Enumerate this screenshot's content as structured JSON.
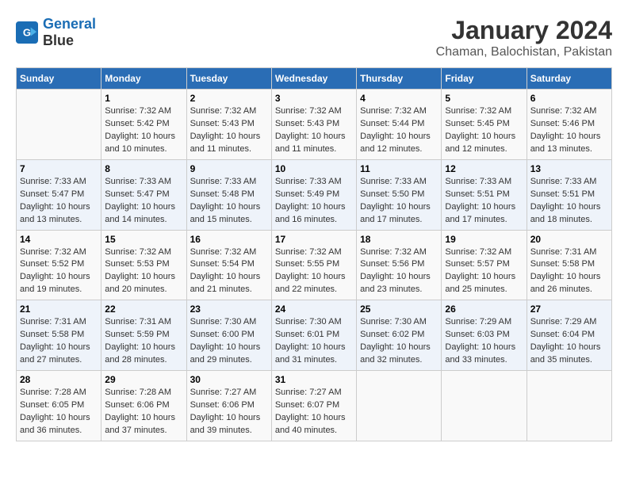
{
  "header": {
    "logo_line1": "General",
    "logo_line2": "Blue",
    "title": "January 2024",
    "subtitle": "Chaman, Balochistan, Pakistan"
  },
  "columns": [
    "Sunday",
    "Monday",
    "Tuesday",
    "Wednesday",
    "Thursday",
    "Friday",
    "Saturday"
  ],
  "weeks": [
    [
      {
        "day": "",
        "info": ""
      },
      {
        "day": "1",
        "info": "Sunrise: 7:32 AM\nSunset: 5:42 PM\nDaylight: 10 hours\nand 10 minutes."
      },
      {
        "day": "2",
        "info": "Sunrise: 7:32 AM\nSunset: 5:43 PM\nDaylight: 10 hours\nand 11 minutes."
      },
      {
        "day": "3",
        "info": "Sunrise: 7:32 AM\nSunset: 5:43 PM\nDaylight: 10 hours\nand 11 minutes."
      },
      {
        "day": "4",
        "info": "Sunrise: 7:32 AM\nSunset: 5:44 PM\nDaylight: 10 hours\nand 12 minutes."
      },
      {
        "day": "5",
        "info": "Sunrise: 7:32 AM\nSunset: 5:45 PM\nDaylight: 10 hours\nand 12 minutes."
      },
      {
        "day": "6",
        "info": "Sunrise: 7:32 AM\nSunset: 5:46 PM\nDaylight: 10 hours\nand 13 minutes."
      }
    ],
    [
      {
        "day": "7",
        "info": "Sunrise: 7:33 AM\nSunset: 5:47 PM\nDaylight: 10 hours\nand 13 minutes."
      },
      {
        "day": "8",
        "info": "Sunrise: 7:33 AM\nSunset: 5:47 PM\nDaylight: 10 hours\nand 14 minutes."
      },
      {
        "day": "9",
        "info": "Sunrise: 7:33 AM\nSunset: 5:48 PM\nDaylight: 10 hours\nand 15 minutes."
      },
      {
        "day": "10",
        "info": "Sunrise: 7:33 AM\nSunset: 5:49 PM\nDaylight: 10 hours\nand 16 minutes."
      },
      {
        "day": "11",
        "info": "Sunrise: 7:33 AM\nSunset: 5:50 PM\nDaylight: 10 hours\nand 17 minutes."
      },
      {
        "day": "12",
        "info": "Sunrise: 7:33 AM\nSunset: 5:51 PM\nDaylight: 10 hours\nand 17 minutes."
      },
      {
        "day": "13",
        "info": "Sunrise: 7:33 AM\nSunset: 5:51 PM\nDaylight: 10 hours\nand 18 minutes."
      }
    ],
    [
      {
        "day": "14",
        "info": "Sunrise: 7:32 AM\nSunset: 5:52 PM\nDaylight: 10 hours\nand 19 minutes."
      },
      {
        "day": "15",
        "info": "Sunrise: 7:32 AM\nSunset: 5:53 PM\nDaylight: 10 hours\nand 20 minutes."
      },
      {
        "day": "16",
        "info": "Sunrise: 7:32 AM\nSunset: 5:54 PM\nDaylight: 10 hours\nand 21 minutes."
      },
      {
        "day": "17",
        "info": "Sunrise: 7:32 AM\nSunset: 5:55 PM\nDaylight: 10 hours\nand 22 minutes."
      },
      {
        "day": "18",
        "info": "Sunrise: 7:32 AM\nSunset: 5:56 PM\nDaylight: 10 hours\nand 23 minutes."
      },
      {
        "day": "19",
        "info": "Sunrise: 7:32 AM\nSunset: 5:57 PM\nDaylight: 10 hours\nand 25 minutes."
      },
      {
        "day": "20",
        "info": "Sunrise: 7:31 AM\nSunset: 5:58 PM\nDaylight: 10 hours\nand 26 minutes."
      }
    ],
    [
      {
        "day": "21",
        "info": "Sunrise: 7:31 AM\nSunset: 5:58 PM\nDaylight: 10 hours\nand 27 minutes."
      },
      {
        "day": "22",
        "info": "Sunrise: 7:31 AM\nSunset: 5:59 PM\nDaylight: 10 hours\nand 28 minutes."
      },
      {
        "day": "23",
        "info": "Sunrise: 7:30 AM\nSunset: 6:00 PM\nDaylight: 10 hours\nand 29 minutes."
      },
      {
        "day": "24",
        "info": "Sunrise: 7:30 AM\nSunset: 6:01 PM\nDaylight: 10 hours\nand 31 minutes."
      },
      {
        "day": "25",
        "info": "Sunrise: 7:30 AM\nSunset: 6:02 PM\nDaylight: 10 hours\nand 32 minutes."
      },
      {
        "day": "26",
        "info": "Sunrise: 7:29 AM\nSunset: 6:03 PM\nDaylight: 10 hours\nand 33 minutes."
      },
      {
        "day": "27",
        "info": "Sunrise: 7:29 AM\nSunset: 6:04 PM\nDaylight: 10 hours\nand 35 minutes."
      }
    ],
    [
      {
        "day": "28",
        "info": "Sunrise: 7:28 AM\nSunset: 6:05 PM\nDaylight: 10 hours\nand 36 minutes."
      },
      {
        "day": "29",
        "info": "Sunrise: 7:28 AM\nSunset: 6:06 PM\nDaylight: 10 hours\nand 37 minutes."
      },
      {
        "day": "30",
        "info": "Sunrise: 7:27 AM\nSunset: 6:06 PM\nDaylight: 10 hours\nand 39 minutes."
      },
      {
        "day": "31",
        "info": "Sunrise: 7:27 AM\nSunset: 6:07 PM\nDaylight: 10 hours\nand 40 minutes."
      },
      {
        "day": "",
        "info": ""
      },
      {
        "day": "",
        "info": ""
      },
      {
        "day": "",
        "info": ""
      }
    ]
  ]
}
